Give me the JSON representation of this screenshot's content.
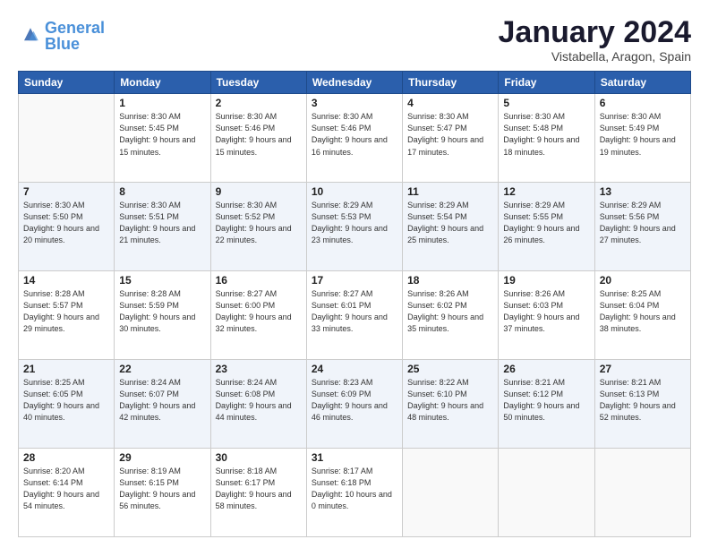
{
  "header": {
    "logo_text_general": "General",
    "logo_text_blue": "Blue",
    "month_title": "January 2024",
    "subtitle": "Vistabella, Aragon, Spain"
  },
  "weekdays": [
    "Sunday",
    "Monday",
    "Tuesday",
    "Wednesday",
    "Thursday",
    "Friday",
    "Saturday"
  ],
  "weeks": [
    [
      {
        "day": "",
        "sunrise": "",
        "sunset": "",
        "daylight": ""
      },
      {
        "day": "1",
        "sunrise": "Sunrise: 8:30 AM",
        "sunset": "Sunset: 5:45 PM",
        "daylight": "Daylight: 9 hours and 15 minutes."
      },
      {
        "day": "2",
        "sunrise": "Sunrise: 8:30 AM",
        "sunset": "Sunset: 5:46 PM",
        "daylight": "Daylight: 9 hours and 15 minutes."
      },
      {
        "day": "3",
        "sunrise": "Sunrise: 8:30 AM",
        "sunset": "Sunset: 5:46 PM",
        "daylight": "Daylight: 9 hours and 16 minutes."
      },
      {
        "day": "4",
        "sunrise": "Sunrise: 8:30 AM",
        "sunset": "Sunset: 5:47 PM",
        "daylight": "Daylight: 9 hours and 17 minutes."
      },
      {
        "day": "5",
        "sunrise": "Sunrise: 8:30 AM",
        "sunset": "Sunset: 5:48 PM",
        "daylight": "Daylight: 9 hours and 18 minutes."
      },
      {
        "day": "6",
        "sunrise": "Sunrise: 8:30 AM",
        "sunset": "Sunset: 5:49 PM",
        "daylight": "Daylight: 9 hours and 19 minutes."
      }
    ],
    [
      {
        "day": "7",
        "sunrise": "Sunrise: 8:30 AM",
        "sunset": "Sunset: 5:50 PM",
        "daylight": "Daylight: 9 hours and 20 minutes."
      },
      {
        "day": "8",
        "sunrise": "Sunrise: 8:30 AM",
        "sunset": "Sunset: 5:51 PM",
        "daylight": "Daylight: 9 hours and 21 minutes."
      },
      {
        "day": "9",
        "sunrise": "Sunrise: 8:30 AM",
        "sunset": "Sunset: 5:52 PM",
        "daylight": "Daylight: 9 hours and 22 minutes."
      },
      {
        "day": "10",
        "sunrise": "Sunrise: 8:29 AM",
        "sunset": "Sunset: 5:53 PM",
        "daylight": "Daylight: 9 hours and 23 minutes."
      },
      {
        "day": "11",
        "sunrise": "Sunrise: 8:29 AM",
        "sunset": "Sunset: 5:54 PM",
        "daylight": "Daylight: 9 hours and 25 minutes."
      },
      {
        "day": "12",
        "sunrise": "Sunrise: 8:29 AM",
        "sunset": "Sunset: 5:55 PM",
        "daylight": "Daylight: 9 hours and 26 minutes."
      },
      {
        "day": "13",
        "sunrise": "Sunrise: 8:29 AM",
        "sunset": "Sunset: 5:56 PM",
        "daylight": "Daylight: 9 hours and 27 minutes."
      }
    ],
    [
      {
        "day": "14",
        "sunrise": "Sunrise: 8:28 AM",
        "sunset": "Sunset: 5:57 PM",
        "daylight": "Daylight: 9 hours and 29 minutes."
      },
      {
        "day": "15",
        "sunrise": "Sunrise: 8:28 AM",
        "sunset": "Sunset: 5:59 PM",
        "daylight": "Daylight: 9 hours and 30 minutes."
      },
      {
        "day": "16",
        "sunrise": "Sunrise: 8:27 AM",
        "sunset": "Sunset: 6:00 PM",
        "daylight": "Daylight: 9 hours and 32 minutes."
      },
      {
        "day": "17",
        "sunrise": "Sunrise: 8:27 AM",
        "sunset": "Sunset: 6:01 PM",
        "daylight": "Daylight: 9 hours and 33 minutes."
      },
      {
        "day": "18",
        "sunrise": "Sunrise: 8:26 AM",
        "sunset": "Sunset: 6:02 PM",
        "daylight": "Daylight: 9 hours and 35 minutes."
      },
      {
        "day": "19",
        "sunrise": "Sunrise: 8:26 AM",
        "sunset": "Sunset: 6:03 PM",
        "daylight": "Daylight: 9 hours and 37 minutes."
      },
      {
        "day": "20",
        "sunrise": "Sunrise: 8:25 AM",
        "sunset": "Sunset: 6:04 PM",
        "daylight": "Daylight: 9 hours and 38 minutes."
      }
    ],
    [
      {
        "day": "21",
        "sunrise": "Sunrise: 8:25 AM",
        "sunset": "Sunset: 6:05 PM",
        "daylight": "Daylight: 9 hours and 40 minutes."
      },
      {
        "day": "22",
        "sunrise": "Sunrise: 8:24 AM",
        "sunset": "Sunset: 6:07 PM",
        "daylight": "Daylight: 9 hours and 42 minutes."
      },
      {
        "day": "23",
        "sunrise": "Sunrise: 8:24 AM",
        "sunset": "Sunset: 6:08 PM",
        "daylight": "Daylight: 9 hours and 44 minutes."
      },
      {
        "day": "24",
        "sunrise": "Sunrise: 8:23 AM",
        "sunset": "Sunset: 6:09 PM",
        "daylight": "Daylight: 9 hours and 46 minutes."
      },
      {
        "day": "25",
        "sunrise": "Sunrise: 8:22 AM",
        "sunset": "Sunset: 6:10 PM",
        "daylight": "Daylight: 9 hours and 48 minutes."
      },
      {
        "day": "26",
        "sunrise": "Sunrise: 8:21 AM",
        "sunset": "Sunset: 6:12 PM",
        "daylight": "Daylight: 9 hours and 50 minutes."
      },
      {
        "day": "27",
        "sunrise": "Sunrise: 8:21 AM",
        "sunset": "Sunset: 6:13 PM",
        "daylight": "Daylight: 9 hours and 52 minutes."
      }
    ],
    [
      {
        "day": "28",
        "sunrise": "Sunrise: 8:20 AM",
        "sunset": "Sunset: 6:14 PM",
        "daylight": "Daylight: 9 hours and 54 minutes."
      },
      {
        "day": "29",
        "sunrise": "Sunrise: 8:19 AM",
        "sunset": "Sunset: 6:15 PM",
        "daylight": "Daylight: 9 hours and 56 minutes."
      },
      {
        "day": "30",
        "sunrise": "Sunrise: 8:18 AM",
        "sunset": "Sunset: 6:17 PM",
        "daylight": "Daylight: 9 hours and 58 minutes."
      },
      {
        "day": "31",
        "sunrise": "Sunrise: 8:17 AM",
        "sunset": "Sunset: 6:18 PM",
        "daylight": "Daylight: 10 hours and 0 minutes."
      },
      {
        "day": "",
        "sunrise": "",
        "sunset": "",
        "daylight": ""
      },
      {
        "day": "",
        "sunrise": "",
        "sunset": "",
        "daylight": ""
      },
      {
        "day": "",
        "sunrise": "",
        "sunset": "",
        "daylight": ""
      }
    ]
  ]
}
